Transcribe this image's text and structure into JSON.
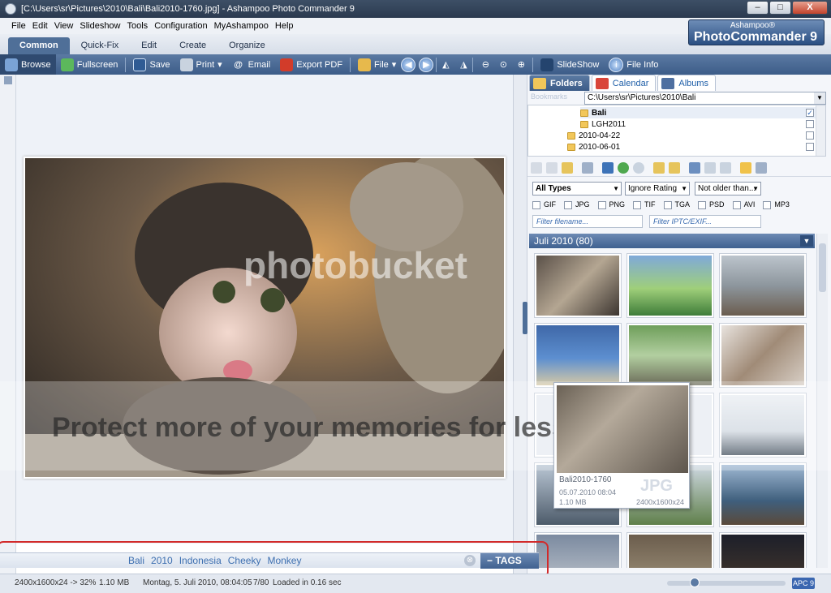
{
  "window": {
    "title": "[C:\\Users\\sr\\Pictures\\2010\\Bali\\Bali2010-1760.jpg] - Ashampoo Photo Commander 9",
    "buttons": [
      "–",
      "□",
      "X"
    ]
  },
  "menu": [
    "File",
    "Edit",
    "View",
    "Slideshow",
    "Tools",
    "Configuration",
    "MyAshampoo",
    "Help"
  ],
  "ribbon_tabs": [
    "Common",
    "Quick-Fix",
    "Edit",
    "Create",
    "Organize"
  ],
  "brand": {
    "small": "Ashampoo®",
    "big": "PhotoCommander 9"
  },
  "toolbar": {
    "browse": "Browse",
    "fullscreen": "Fullscreen",
    "save": "Save",
    "print": "Print",
    "email": "Email",
    "export_pdf": "Export PDF",
    "file": "File",
    "slideshow": "SlideShow",
    "file_info": "File Info"
  },
  "panel": {
    "tabs": [
      "Folders",
      "Calendar",
      "Albums"
    ],
    "bookmarks": "Bookmarks",
    "path": "C:\\Users\\sr\\Pictures\\2010\\Bali",
    "tree": [
      {
        "label": "Bali",
        "checked": true
      },
      {
        "label": "LGH2011",
        "checked": false
      },
      {
        "label": "2010-04-22",
        "checked": false
      },
      {
        "label": "2010-06-01",
        "checked": false
      }
    ],
    "filters": {
      "type": "All Types",
      "rating": "Ignore Rating",
      "age": "Not older than...",
      "types": [
        "GIF",
        "JPG",
        "PNG",
        "TIF",
        "TGA",
        "PSD",
        "AVI",
        "MP3"
      ],
      "filename_placeholder": "Filter filename...",
      "iptc_placeholder": "Filter IPTC/EXIF..."
    },
    "group": "Juli 2010 (80)"
  },
  "tooltip": {
    "name": "Bali2010-1760",
    "date": "05.07.2010 08:04",
    "size": "1.10 MB",
    "dims": "2400x1600x24",
    "format": "JPG"
  },
  "watermark": {
    "line1": "photobucket",
    "line2": "Protect more of your memories for less!"
  },
  "tags": {
    "items": [
      "Bali",
      "2010",
      "Indonesia",
      "Cheeky",
      "Monkey"
    ],
    "clear": "⊗",
    "button": "−  TAGS"
  },
  "status": {
    "dims": "2400x1600x24 -> 32%",
    "size": "1.10 MB",
    "date": "Montag, 5. Juli 2010, 08:04:05",
    "index": "7/80",
    "loaded": "Loaded in 0.16 sec",
    "apc": "APC 9"
  }
}
